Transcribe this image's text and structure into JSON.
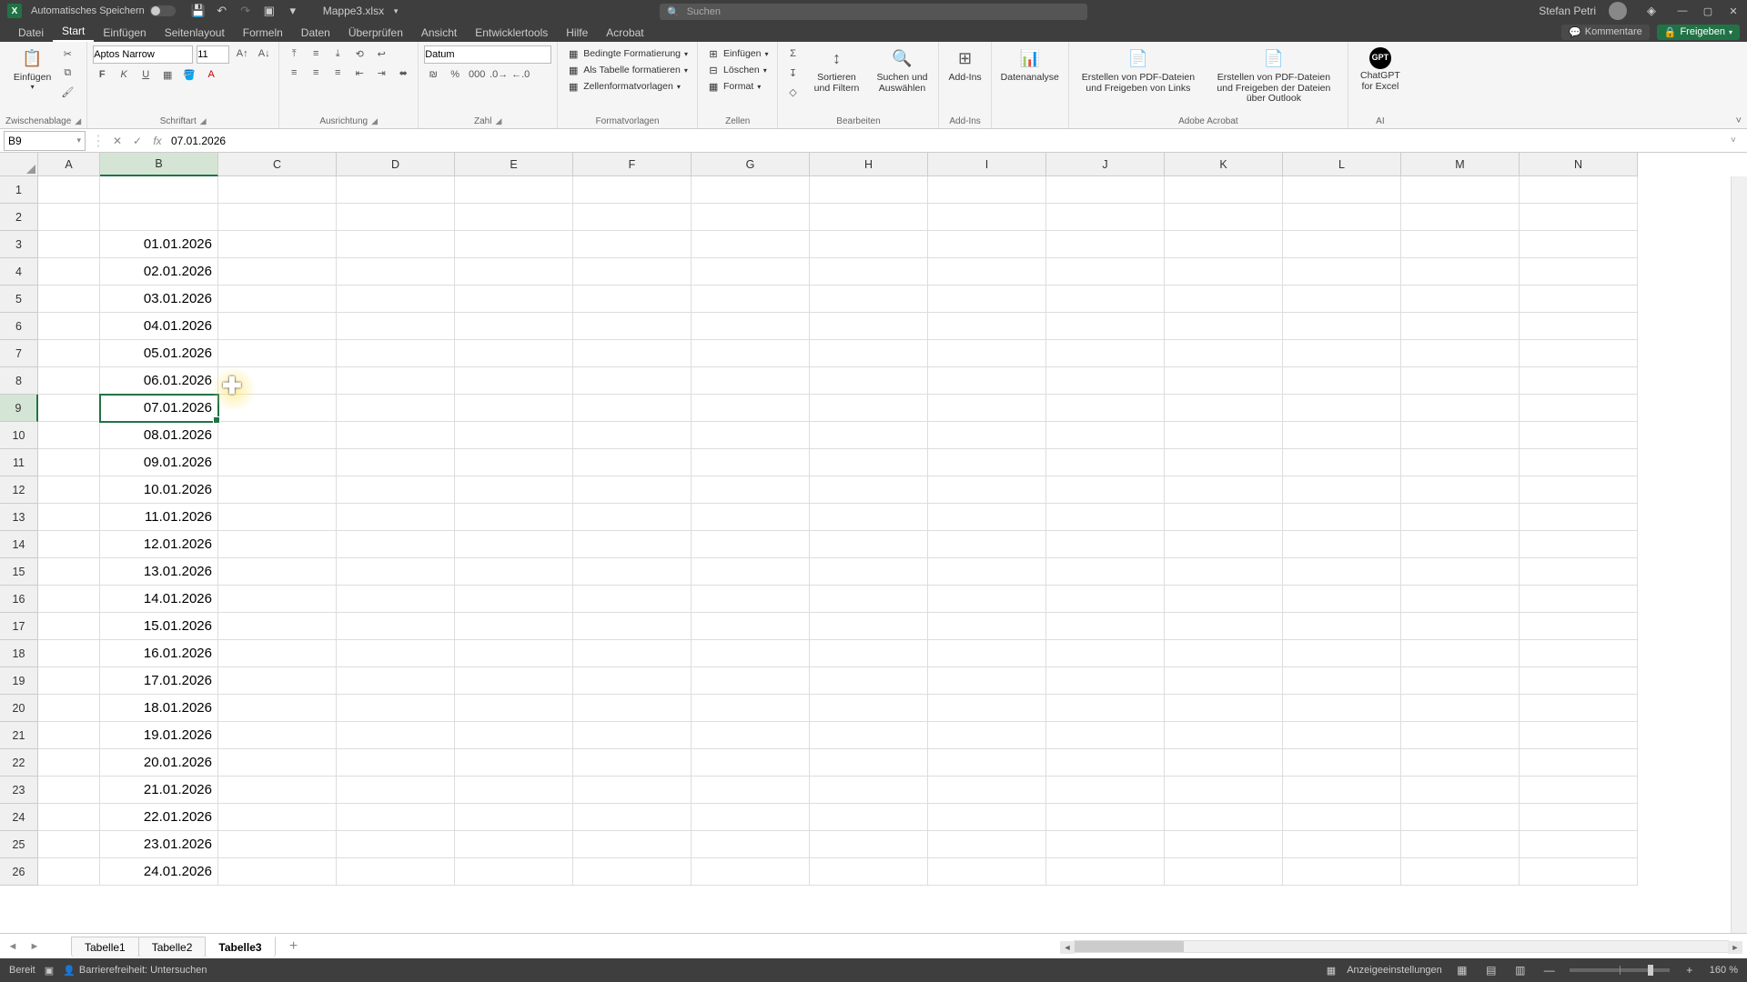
{
  "title_bar": {
    "autosave_label": "Automatisches Speichern",
    "doc_name": "Mappe3.xlsx",
    "search_placeholder": "Suchen",
    "user_name": "Stefan Petri"
  },
  "menu_tabs": {
    "file": "Datei",
    "start": "Start",
    "insert": "Einfügen",
    "layout": "Seitenlayout",
    "formulas": "Formeln",
    "data": "Daten",
    "review": "Überprüfen",
    "view": "Ansicht",
    "developer": "Entwicklertools",
    "help": "Hilfe",
    "acrobat": "Acrobat",
    "comments": "Kommentare",
    "share": "Freigeben"
  },
  "ribbon": {
    "clipboard": {
      "paste": "Einfügen",
      "label": "Zwischenablage"
    },
    "font": {
      "name": "Aptos Narrow",
      "size": "11",
      "label": "Schriftart"
    },
    "alignment": {
      "label": "Ausrichtung"
    },
    "number": {
      "format": "Datum",
      "label": "Zahl"
    },
    "styles": {
      "cond": "Bedingte Formatierung",
      "table": "Als Tabelle formatieren",
      "cell": "Zellenformatvorlagen",
      "label": "Formatvorlagen"
    },
    "cells": {
      "insert": "Einfügen",
      "delete": "Löschen",
      "format": "Format",
      "label": "Zellen"
    },
    "editing": {
      "sort": "Sortieren und Filtern",
      "find": "Suchen und Auswählen",
      "label": "Bearbeiten"
    },
    "addins": {
      "addins_btn": "Add-Ins",
      "label": "Add-Ins"
    },
    "analysis": {
      "btn": "Datenanalyse"
    },
    "acrobat": {
      "create": "Erstellen von PDF-Dateien und Freigeben von Links",
      "create2": "Erstellen von PDF-Dateien und Freigeben der Dateien über Outlook",
      "label": "Adobe Acrobat"
    },
    "ai": {
      "gpt": "ChatGPT for Excel",
      "label": "AI"
    }
  },
  "name_box": "B9",
  "formula_bar": "07.01.2026",
  "columns": [
    "A",
    "B",
    "C",
    "D",
    "E",
    "F",
    "G",
    "H",
    "I",
    "J",
    "K",
    "L",
    "M",
    "N"
  ],
  "row_count": 26,
  "selected_row": 9,
  "selected_col": "B",
  "cells": {
    "B3": "01.01.2026",
    "B4": "02.01.2026",
    "B5": "03.01.2026",
    "B6": "04.01.2026",
    "B7": "05.01.2026",
    "B8": "06.01.2026",
    "B9": "07.01.2026",
    "B10": "08.01.2026",
    "B11": "09.01.2026",
    "B12": "10.01.2026",
    "B13": "11.01.2026",
    "B14": "12.01.2026",
    "B15": "13.01.2026",
    "B16": "14.01.2026",
    "B17": "15.01.2026",
    "B18": "16.01.2026",
    "B19": "17.01.2026",
    "B20": "18.01.2026",
    "B21": "19.01.2026",
    "B22": "20.01.2026",
    "B23": "21.01.2026",
    "B24": "22.01.2026",
    "B25": "23.01.2026",
    "B26": "24.01.2026"
  },
  "sheets": {
    "s1": "Tabelle1",
    "s2": "Tabelle2",
    "s3": "Tabelle3"
  },
  "status": {
    "ready": "Bereit",
    "accessibility": "Barrierefreiheit: Untersuchen",
    "display": "Anzeigeeinstellungen",
    "zoom": "160 %"
  }
}
